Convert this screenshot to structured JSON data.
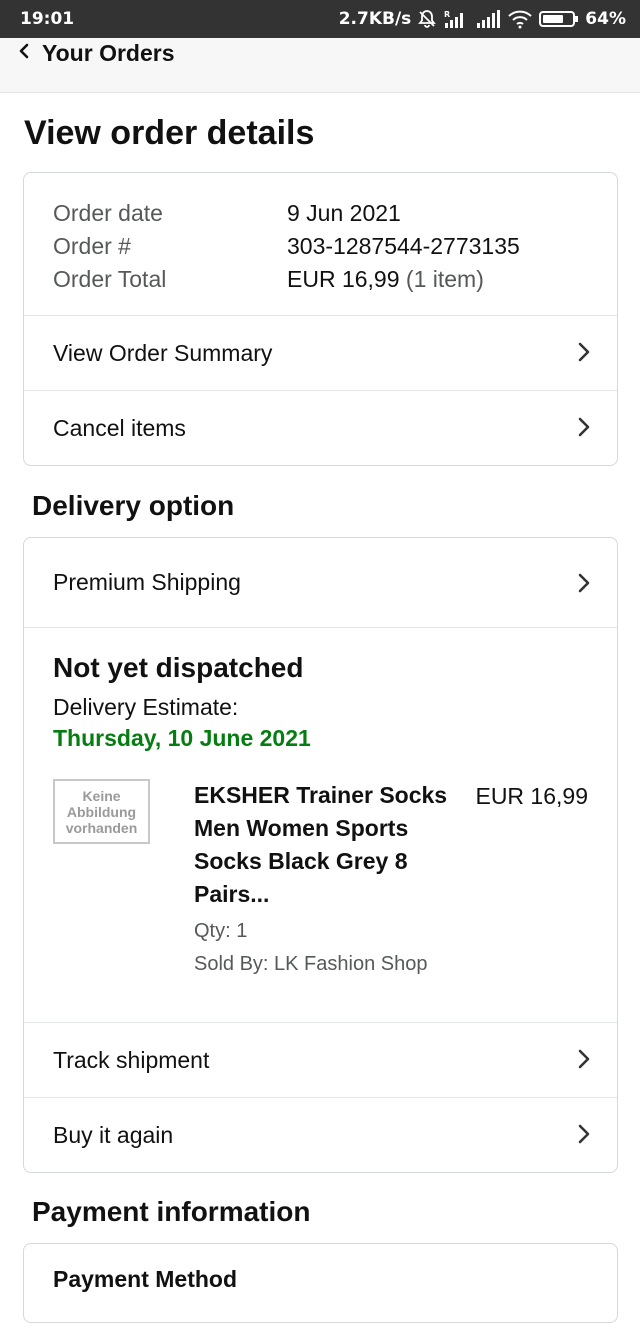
{
  "status_bar": {
    "time": "19:01",
    "network_speed": "2.7KB/s",
    "battery": "64%",
    "icons": [
      "bell-off-icon",
      "signal-icon",
      "signal-icon",
      "wifi-icon",
      "battery-icon"
    ]
  },
  "nav": {
    "back_label": "Your Orders",
    "back_icon": "chevron-left-icon"
  },
  "page": {
    "title": "View order details"
  },
  "order": {
    "date_label": "Order date",
    "date_value": "9 Jun 2021",
    "number_label": "Order #",
    "number_value": "303-1287544-2773135",
    "total_label": "Order Total",
    "total_value": "EUR 16,99",
    "total_items": "(1 item)"
  },
  "order_actions": {
    "summary_label": "View Order Summary",
    "cancel_label": "Cancel items"
  },
  "delivery": {
    "heading": "Delivery option",
    "shipping_label": "Premium Shipping",
    "status": "Not yet dispatched",
    "estimate_label": "Delivery Estimate:",
    "estimate_date": "Thursday, 10 June 2021",
    "track_label": "Track shipment",
    "buy_again_label": "Buy it again"
  },
  "item": {
    "image_placeholder": "Keine Abbildung vorhanden",
    "title": "EKSHER Trainer Socks Men Women Sports Socks Black Grey 8 Pairs...",
    "qty": "Qty: 1",
    "seller": "Sold By: LK Fashion Shop",
    "price": "EUR 16,99"
  },
  "payment": {
    "heading": "Payment information",
    "method_label": "Payment Method"
  },
  "colors": {
    "status_bar_bg": "#333333",
    "nav_bg": "#f7f7f7",
    "delivery_date_green": "#067d10",
    "secondary_text": "#565959",
    "card_border": "#d5d9d9"
  }
}
